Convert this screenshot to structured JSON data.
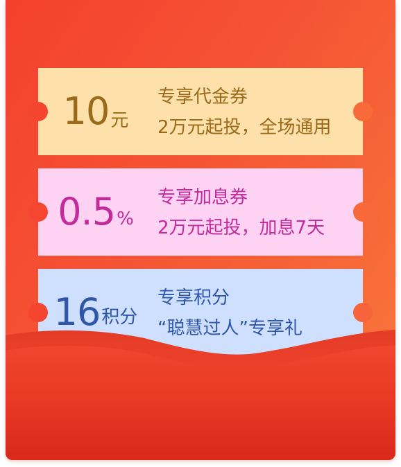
{
  "coupons": [
    {
      "amount": "10",
      "unit": "元",
      "title": "专享代金券",
      "subtitle": "2万元起投，全场通用",
      "bg_color": "#fde0aa",
      "text_color": "#9a6a1a"
    },
    {
      "amount": "0.5",
      "unit": "%",
      "title": "专享加息券",
      "subtitle": "2万元起投，加息7天",
      "bg_color": "#fdd2f2",
      "text_color": "#c22b9a"
    },
    {
      "amount": "16",
      "unit": "积分",
      "title": "专享积分",
      "subtitle": "“聪慧过人”专享礼",
      "bg_color": "#cfe0ff",
      "text_color": "#2f56a8"
    }
  ],
  "colors": {
    "envelope_start": "#f4402e",
    "envelope_end": "#f97a3c",
    "pocket": "#e8321f"
  }
}
